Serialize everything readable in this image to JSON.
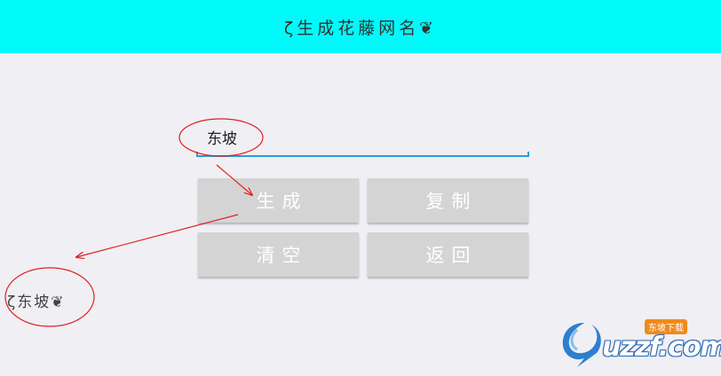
{
  "header": {
    "title": "ζ生成花藤网名❦"
  },
  "form": {
    "name_value": "东坡"
  },
  "buttons": {
    "generate": "生成",
    "copy": "复制",
    "clear": "清空",
    "back": "返回"
  },
  "result": {
    "text": "ζ东坡❦"
  },
  "watermark": {
    "text": "uzzf.com",
    "badge": "东坡下载"
  },
  "colors": {
    "header_bg": "#00fafa",
    "accent": "#2a9bd6",
    "button_bg": "#d4d4d4",
    "annotation": "#e02020"
  }
}
